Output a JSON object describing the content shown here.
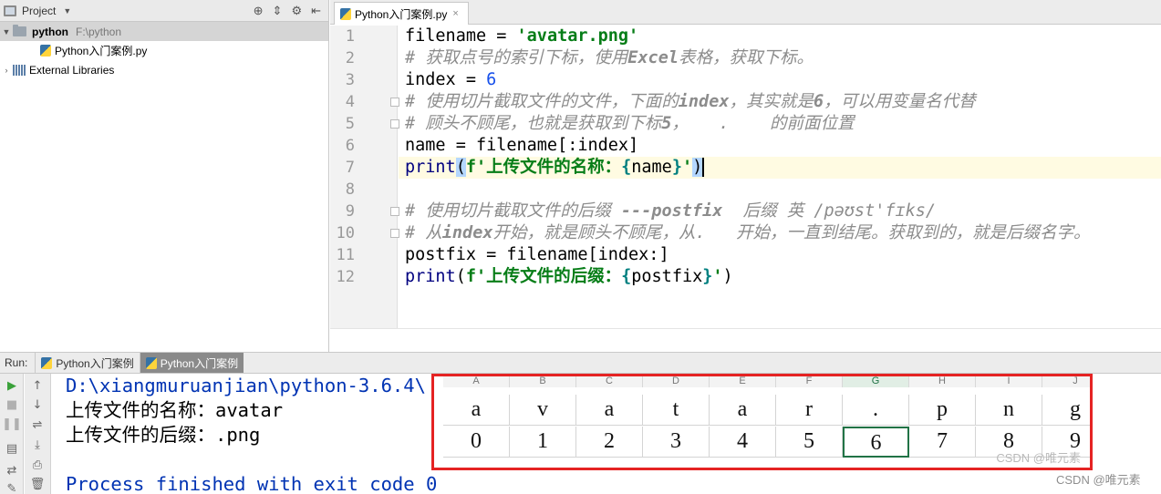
{
  "project": {
    "header_title": "Project",
    "root_name": "python",
    "root_path": "F:\\python",
    "file_name": "Python入门案例.py",
    "external_libraries": "External Libraries"
  },
  "editor": {
    "tab_label": "Python入门案例.py",
    "line_numbers": [
      "1",
      "2",
      "3",
      "4",
      "5",
      "6",
      "7",
      "8",
      "9",
      "10",
      "11",
      "12"
    ],
    "lines": {
      "l1": {
        "a": "filename = ",
        "b": "'avatar.png'"
      },
      "l2": {
        "a": "# 获取点号的索引下标，使用",
        "b": "Excel",
        "c": "表格，获取下标。"
      },
      "l3": {
        "a": "index = ",
        "b": "6"
      },
      "l4": {
        "a": "# 使用切片截取文件的文件，下面的",
        "b": "index",
        "c": "，其实就是",
        "d": "6",
        "e": "，可以用变量名代替"
      },
      "l5": {
        "a": "# 顾头不顾尾，也就是获取到下标",
        "b": "5",
        "c": "，   .    的前面位置"
      },
      "l6": {
        "a": "name = filename[:index]"
      },
      "l7": {
        "a": "print",
        "b": "(",
        "c": "f'上传文件的名称：",
        "d": "{",
        "e": "name",
        "f": "}",
        "g": "'",
        "h": ")"
      },
      "l9": {
        "a": "# 使用切片截取文件的后缀 ",
        "b": "---postfix",
        "c": "  后缀 英 ",
        "d": "/pəʊst'fɪks/"
      },
      "l10": {
        "a": "# 从",
        "b": "index",
        "c": "开始，就是顾头不顾尾，从.   开始，一直到结尾。获取到的，就是后缀名字。"
      },
      "l11": {
        "a": "postfix = filename[index:]"
      },
      "l12": {
        "a": "print",
        "b": "(",
        "c": "f'上传文件的后缀：",
        "d": "{",
        "e": "postfix",
        "f": "}",
        "g": "'",
        "h": ")"
      }
    }
  },
  "run": {
    "label": "Run:",
    "tabs": [
      "Python入门案例",
      "Python入门案例"
    ],
    "console": {
      "path_line": "D:\\xiangmuruanjian\\python-3.6.4\\",
      "name_line": "上传文件的名称：avatar",
      "postfix_line": "上传文件的后缀：.png",
      "exit_line": "Process finished with exit code 0"
    }
  },
  "overlay": {
    "columns": [
      "A",
      "B",
      "C",
      "D",
      "E",
      "F",
      "G",
      "H",
      "I",
      "J"
    ],
    "selected_column": "G",
    "chars": [
      "a",
      "v",
      "a",
      "t",
      "a",
      "r",
      ".",
      "p",
      "n",
      "g"
    ],
    "indices": [
      "0",
      "1",
      "2",
      "3",
      "4",
      "5",
      "6",
      "7",
      "8",
      "9"
    ],
    "watermark_inner": "CSDN @唯元素",
    "border_color": "#e52323"
  },
  "watermark": "CSDN @唯元素",
  "colors": {
    "string": "#067d17",
    "number": "#1750eb",
    "builtin": "#000080",
    "comment": "#8c8c8c",
    "console_blue": "#0033b3"
  }
}
